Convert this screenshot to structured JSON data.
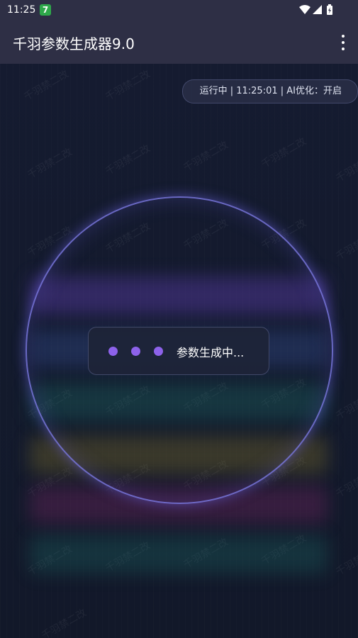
{
  "status_bar": {
    "time": "11:25",
    "app_badge": "7",
    "icons": [
      "wifi-icon",
      "signal-icon",
      "battery-charging-icon"
    ]
  },
  "app_bar": {
    "title": "千羽参数生成器9.0",
    "menu_icon": "more-vert-icon"
  },
  "status_pill": {
    "text": "运行中 | 11:25:01 | AI优化：开启"
  },
  "loading": {
    "text": "参数生成中..."
  },
  "watermark": {
    "text": "千羽禁二改"
  },
  "colors": {
    "bar_background": "#2e2f45",
    "page_background": "#141a2e",
    "accent_purple": "#8d62ea",
    "ring": "#7876dc"
  }
}
